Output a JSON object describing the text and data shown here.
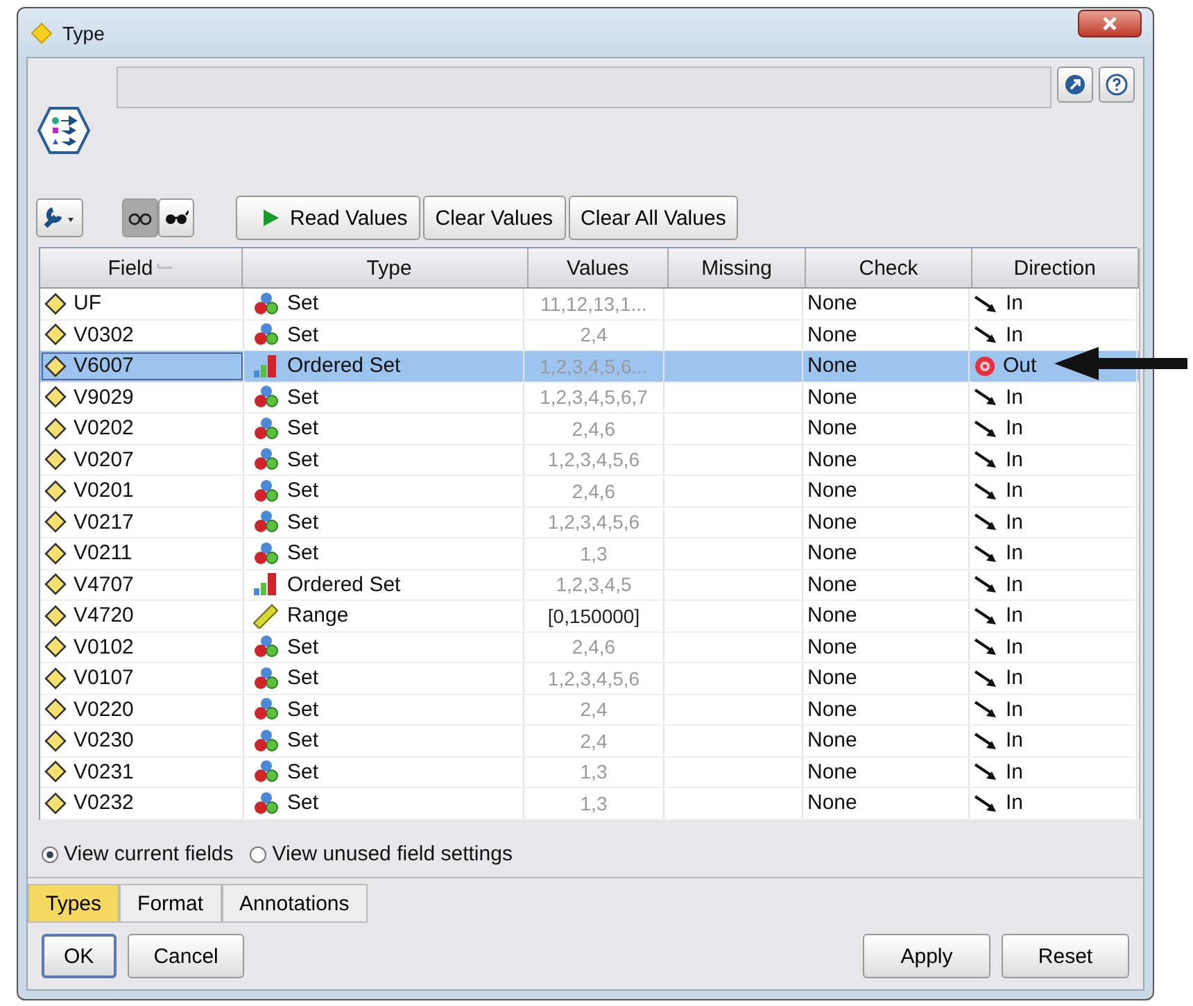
{
  "window": {
    "title": "Type"
  },
  "toolbar": {
    "buttons": [
      "Read Values",
      "Clear Values",
      "Clear All Values"
    ]
  },
  "table": {
    "columns": [
      "Field",
      "Type",
      "Values",
      "Missing",
      "Check",
      "Direction"
    ],
    "rows": [
      {
        "field": "UF",
        "type": {
          "label": "Set",
          "kind": "set"
        },
        "values": "11,12,13,1...",
        "check": "None",
        "direction": {
          "label": "In",
          "kind": "in"
        },
        "selected": false
      },
      {
        "field": "V0302",
        "type": {
          "label": "Set",
          "kind": "set"
        },
        "values": "2,4",
        "check": "None",
        "direction": {
          "label": "In",
          "kind": "in"
        },
        "selected": false
      },
      {
        "field": "V6007",
        "type": {
          "label": "Ordered Set",
          "kind": "ordered"
        },
        "values": "1,2,3,4,5,6...",
        "check": "None",
        "direction": {
          "label": "Out",
          "kind": "out"
        },
        "selected": true
      },
      {
        "field": "V9029",
        "type": {
          "label": "Set",
          "kind": "set"
        },
        "values": "1,2,3,4,5,6,7",
        "check": "None",
        "direction": {
          "label": "In",
          "kind": "in"
        },
        "selected": false
      },
      {
        "field": "V0202",
        "type": {
          "label": "Set",
          "kind": "set"
        },
        "values": "2,4,6",
        "check": "None",
        "direction": {
          "label": "In",
          "kind": "in"
        },
        "selected": false
      },
      {
        "field": "V0207",
        "type": {
          "label": "Set",
          "kind": "set"
        },
        "values": "1,2,3,4,5,6",
        "check": "None",
        "direction": {
          "label": "In",
          "kind": "in"
        },
        "selected": false
      },
      {
        "field": "V0201",
        "type": {
          "label": "Set",
          "kind": "set"
        },
        "values": "2,4,6",
        "check": "None",
        "direction": {
          "label": "In",
          "kind": "in"
        },
        "selected": false
      },
      {
        "field": "V0217",
        "type": {
          "label": "Set",
          "kind": "set"
        },
        "values": "1,2,3,4,5,6",
        "check": "None",
        "direction": {
          "label": "In",
          "kind": "in"
        },
        "selected": false
      },
      {
        "field": "V0211",
        "type": {
          "label": "Set",
          "kind": "set"
        },
        "values": "1,3",
        "check": "None",
        "direction": {
          "label": "In",
          "kind": "in"
        },
        "selected": false
      },
      {
        "field": "V4707",
        "type": {
          "label": "Ordered Set",
          "kind": "ordered"
        },
        "values": "1,2,3,4,5",
        "check": "None",
        "direction": {
          "label": "In",
          "kind": "in"
        },
        "selected": false
      },
      {
        "field": "V4720",
        "type": {
          "label": "Range",
          "kind": "range"
        },
        "values": "[0,150000]",
        "check": "None",
        "direction": {
          "label": "In",
          "kind": "in"
        },
        "selected": false
      },
      {
        "field": "V0102",
        "type": {
          "label": "Set",
          "kind": "set"
        },
        "values": "2,4,6",
        "check": "None",
        "direction": {
          "label": "In",
          "kind": "in"
        },
        "selected": false
      },
      {
        "field": "V0107",
        "type": {
          "label": "Set",
          "kind": "set"
        },
        "values": "1,2,3,4,5,6",
        "check": "None",
        "direction": {
          "label": "In",
          "kind": "in"
        },
        "selected": false
      },
      {
        "field": "V0220",
        "type": {
          "label": "Set",
          "kind": "set"
        },
        "values": "2,4",
        "check": "None",
        "direction": {
          "label": "In",
          "kind": "in"
        },
        "selected": false
      },
      {
        "field": "V0230",
        "type": {
          "label": "Set",
          "kind": "set"
        },
        "values": "2,4",
        "check": "None",
        "direction": {
          "label": "In",
          "kind": "in"
        },
        "selected": false
      },
      {
        "field": "V0231",
        "type": {
          "label": "Set",
          "kind": "set"
        },
        "values": "1,3",
        "check": "None",
        "direction": {
          "label": "In",
          "kind": "in"
        },
        "selected": false
      },
      {
        "field": "V0232",
        "type": {
          "label": "Set",
          "kind": "set"
        },
        "values": "1,3",
        "check": "None",
        "direction": {
          "label": "In",
          "kind": "in"
        },
        "selected": false
      }
    ]
  },
  "view_options": [
    {
      "label": "View current fields",
      "selected": true
    },
    {
      "label": "View unused field settings",
      "selected": false
    }
  ],
  "tabs": [
    {
      "label": "Types",
      "selected": true
    },
    {
      "label": "Format",
      "selected": false
    },
    {
      "label": "Annotations",
      "selected": false
    }
  ],
  "buttons_left": [
    "OK",
    "Cancel"
  ],
  "buttons_right": [
    "Apply",
    "Reset"
  ]
}
